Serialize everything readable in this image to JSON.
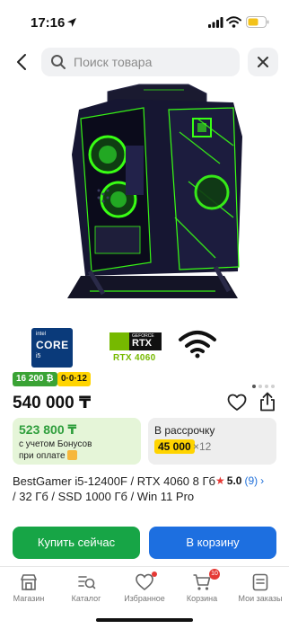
{
  "status_bar": {
    "time": "17:16"
  },
  "search": {
    "placeholder": "Поиск товара"
  },
  "brands": {
    "intel_line1": "intel",
    "intel_line2": "CORE",
    "intel_line3": "i5",
    "nvidia_small": "GEFORCE",
    "nvidia_main": "RTX",
    "gpu_label": "RTX 4060"
  },
  "badges": {
    "bonus": "16 200 ₿",
    "installment": "0·0·12"
  },
  "gallery": {
    "slides_count": 4,
    "active_slide": 1
  },
  "price": "540 000 ₸",
  "offers": {
    "bonus_price": "523 800 ₸",
    "bonus_line1": "с учетом Бонусов",
    "bonus_line2": "при оплате",
    "installment_title": "В рассрочку",
    "installment_amount": "45 000",
    "installment_months": "×12"
  },
  "product": {
    "title": "BestGamer i5-12400F / RTX 4060 8 Гб / 32 Гб / SSD 1000 Гб / Win 11 Pro",
    "rating": "5.0",
    "reviews": "(9)"
  },
  "actions": {
    "buy_now": "Купить сейчас",
    "add_to_cart": "В корзину"
  },
  "nav": {
    "items": [
      {
        "label": "Магазин",
        "icon": "shop-icon"
      },
      {
        "label": "Каталог",
        "icon": "catalog-icon"
      },
      {
        "label": "Избранное",
        "icon": "heart-icon"
      },
      {
        "label": "Корзина",
        "icon": "cart-icon",
        "badge": "10"
      },
      {
        "label": "Мои заказы",
        "icon": "orders-icon"
      }
    ]
  },
  "colors": {
    "green": "#17a546",
    "blue": "#1d6fe0",
    "yellow": "#ffd400",
    "badge_red": "#e53935"
  }
}
